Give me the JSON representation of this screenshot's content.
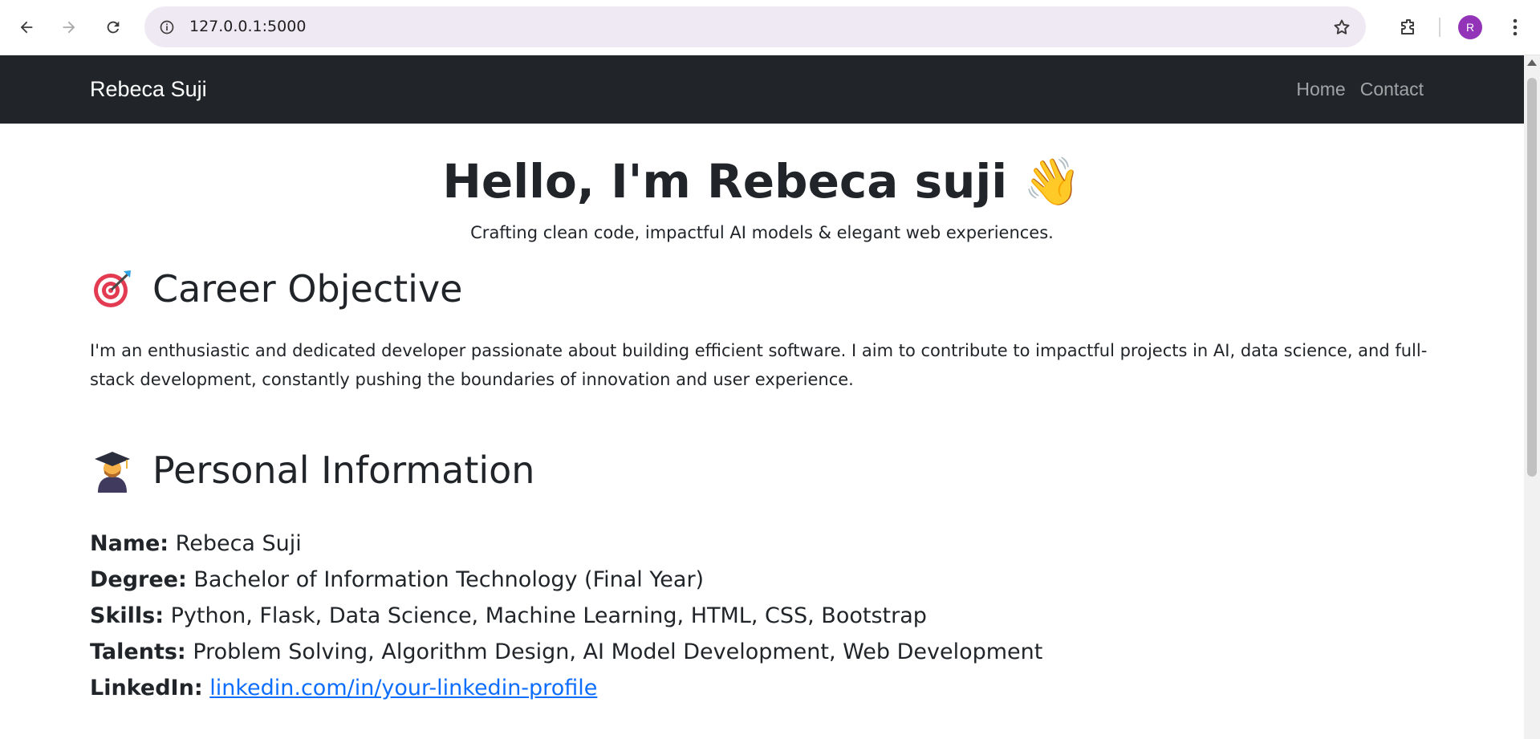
{
  "browser": {
    "url": "127.0.0.1:5000",
    "profile_initial": "R"
  },
  "navbar": {
    "brand": "Rebeca Suji",
    "links": [
      "Home",
      "Contact"
    ]
  },
  "hero": {
    "title": "Hello, I'm Rebeca suji 👋",
    "subtitle": "Crafting clean code, impactful AI models & elegant web experiences."
  },
  "career": {
    "heading": "Career Objective",
    "icon": "target-icon",
    "text": "I'm an enthusiastic and dedicated developer passionate about building efficient software. I aim to contribute to impactful projects in AI, data science, and full-stack development, constantly pushing the boundaries of innovation and user experience."
  },
  "personal": {
    "heading": "Personal Information",
    "icon": "student-icon",
    "rows": [
      {
        "label": "Name:",
        "value": "Rebeca Suji"
      },
      {
        "label": "Degree:",
        "value": "Bachelor of Information Technology (Final Year)"
      },
      {
        "label": "Skills:",
        "value": "Python, Flask, Data Science, Machine Learning, HTML, CSS, Bootstrap"
      },
      {
        "label": "Talents:",
        "value": "Problem Solving, Algorithm Design, AI Model Development, Web Development"
      },
      {
        "label": "LinkedIn:",
        "value": "linkedin.com/in/your-linkedin-profile"
      }
    ]
  },
  "colors": {
    "navbar_bg": "#212529",
    "link": "#0d6efd",
    "avatar": "#9334b8"
  }
}
